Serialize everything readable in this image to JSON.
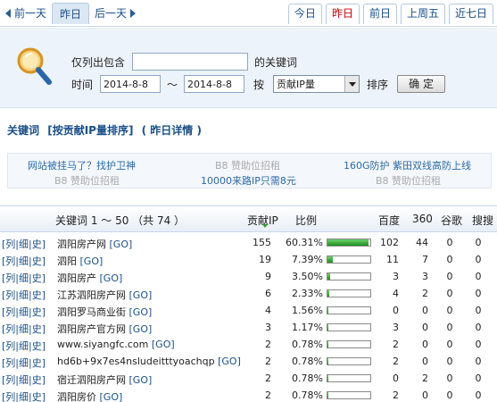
{
  "nav": {
    "prev": "前一天",
    "current": "昨日",
    "next": "后一天",
    "tabs": [
      "今日",
      "昨日",
      "前日",
      "上周五",
      "近七日"
    ]
  },
  "filter": {
    "contains_label": "仅列出包含",
    "contains_value": "",
    "keyword_suffix": "的关键词",
    "time_label": "时间",
    "date_from": "2014-8-8",
    "tilde": "～",
    "date_to": "2014-8-8",
    "by_label": "按",
    "sort_field": "贡献IP量",
    "sort_label": "排序",
    "confirm": "确 定"
  },
  "section": {
    "title": "关键词",
    "sort_by": "[按贡献IP量排序]",
    "detail": "( 昨日详情 )"
  },
  "ads": [
    "网站被挂马了？找护卫神",
    "B8 赞助位招租",
    "160G防护 紫田双线高防上线",
    "B8 赞助位招租",
    "10000来路IP只需8元",
    "B8 赞助位招租"
  ],
  "table": {
    "headers": {
      "keyword": "关键词 1 ～ 50 （共 74 ）",
      "ip": "贡献IP",
      "ratio": "比例",
      "baidu": "百度",
      "s360": "360",
      "google": "谷歌",
      "sogou": "搜搜"
    },
    "ops": [
      "[列",
      "|细",
      "|史]"
    ],
    "go": "[GO]",
    "rows": [
      {
        "keyword": "泗阳房产网",
        "ip": "155",
        "pct": "60.31%",
        "ratio": 0.95,
        "baidu": "102",
        "s360": "44",
        "google": "0",
        "sogou": "0"
      },
      {
        "keyword": "泗阳",
        "ip": "19",
        "pct": "7.39%",
        "ratio": 0.12,
        "baidu": "11",
        "s360": "7",
        "google": "0",
        "sogou": "0"
      },
      {
        "keyword": "泗阳房产",
        "ip": "9",
        "pct": "3.50%",
        "ratio": 0.06,
        "baidu": "3",
        "s360": "3",
        "google": "0",
        "sogou": "0"
      },
      {
        "keyword": "江苏泗阳房产网",
        "ip": "6",
        "pct": "2.33%",
        "ratio": 0.04,
        "baidu": "4",
        "s360": "2",
        "google": "0",
        "sogou": "0"
      },
      {
        "keyword": "泗阳罗马商业街",
        "ip": "4",
        "pct": "1.56%",
        "ratio": 0.03,
        "baidu": "0",
        "s360": "0",
        "google": "0",
        "sogou": "0"
      },
      {
        "keyword": "泗阳房产官方网",
        "ip": "3",
        "pct": "1.17%",
        "ratio": 0.02,
        "baidu": "3",
        "s360": "0",
        "google": "0",
        "sogou": "0"
      },
      {
        "keyword": "www.siyangfc.com",
        "ip": "2",
        "pct": "0.78%",
        "ratio": 0.015,
        "baidu": "2",
        "s360": "0",
        "google": "0",
        "sogou": "0"
      },
      {
        "keyword": "hd6b+9x7es4nsludeitttyoachqp",
        "ip": "2",
        "pct": "0.78%",
        "ratio": 0.015,
        "baidu": "2",
        "s360": "0",
        "google": "0",
        "sogou": "0"
      },
      {
        "keyword": "宿迁泗阳房产网",
        "ip": "2",
        "pct": "0.78%",
        "ratio": 0.015,
        "baidu": "0",
        "s360": "2",
        "google": "0",
        "sogou": "0"
      },
      {
        "keyword": "泗阳房价",
        "ip": "2",
        "pct": "0.78%",
        "ratio": 0.015,
        "baidu": "2",
        "s360": "0",
        "google": "0",
        "sogou": "0"
      }
    ]
  }
}
